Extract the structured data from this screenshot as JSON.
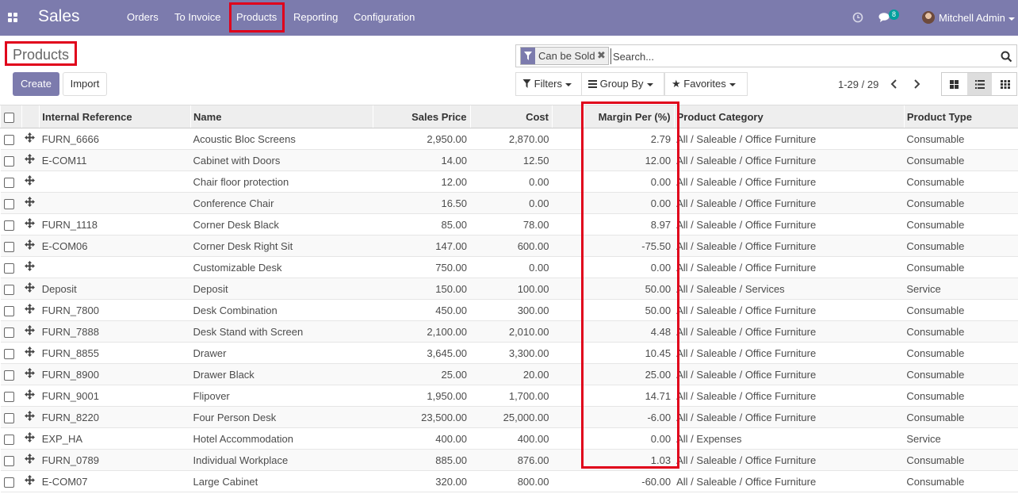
{
  "app": {
    "title": "Sales"
  },
  "menu": [
    {
      "label": "Orders"
    },
    {
      "label": "To Invoice"
    },
    {
      "label": "Products"
    },
    {
      "label": "Reporting"
    },
    {
      "label": "Configuration"
    }
  ],
  "systray": {
    "message_count": "8",
    "user_name": "Mitchell Admin"
  },
  "breadcrumb": {
    "title": "Products"
  },
  "buttons": {
    "create": "Create",
    "import": "Import"
  },
  "search": {
    "facet": "Can be Sold",
    "placeholder": "Search..."
  },
  "filters": {
    "filters": "Filters",
    "group_by": "Group By",
    "favorites": "Favorites"
  },
  "pager": {
    "range": "1-29 / 29"
  },
  "table": {
    "columns": [
      "Internal Reference",
      "Name",
      "Sales Price",
      "Cost",
      "Margin Per (%)",
      "Product Category",
      "Product Type"
    ],
    "rows": [
      [
        "FURN_6666",
        "Acoustic Bloc Screens",
        "2,950.00",
        "2,870.00",
        "2.79",
        "All / Saleable / Office Furniture",
        "Consumable"
      ],
      [
        "E-COM11",
        "Cabinet with Doors",
        "14.00",
        "12.50",
        "12.00",
        "All / Saleable / Office Furniture",
        "Consumable"
      ],
      [
        "",
        "Chair floor protection",
        "12.00",
        "0.00",
        "0.00",
        "All / Saleable / Office Furniture",
        "Consumable"
      ],
      [
        "",
        "Conference Chair",
        "16.50",
        "0.00",
        "0.00",
        "All / Saleable / Office Furniture",
        "Consumable"
      ],
      [
        "FURN_1118",
        "Corner Desk Black",
        "85.00",
        "78.00",
        "8.97",
        "All / Saleable / Office Furniture",
        "Consumable"
      ],
      [
        "E-COM06",
        "Corner Desk Right Sit",
        "147.00",
        "600.00",
        "-75.50",
        "All / Saleable / Office Furniture",
        "Consumable"
      ],
      [
        "",
        "Customizable Desk",
        "750.00",
        "0.00",
        "0.00",
        "All / Saleable / Office Furniture",
        "Consumable"
      ],
      [
        "Deposit",
        "Deposit",
        "150.00",
        "100.00",
        "50.00",
        "All / Saleable / Services",
        "Service"
      ],
      [
        "FURN_7800",
        "Desk Combination",
        "450.00",
        "300.00",
        "50.00",
        "All / Saleable / Office Furniture",
        "Consumable"
      ],
      [
        "FURN_7888",
        "Desk Stand with Screen",
        "2,100.00",
        "2,010.00",
        "4.48",
        "All / Saleable / Office Furniture",
        "Consumable"
      ],
      [
        "FURN_8855",
        "Drawer",
        "3,645.00",
        "3,300.00",
        "10.45",
        "All / Saleable / Office Furniture",
        "Consumable"
      ],
      [
        "FURN_8900",
        "Drawer Black",
        "25.00",
        "20.00",
        "25.00",
        "All / Saleable / Office Furniture",
        "Consumable"
      ],
      [
        "FURN_9001",
        "Flipover",
        "1,950.00",
        "1,700.00",
        "14.71",
        "All / Saleable / Office Furniture",
        "Consumable"
      ],
      [
        "FURN_8220",
        "Four Person Desk",
        "23,500.00",
        "25,000.00",
        "-6.00",
        "All / Saleable / Office Furniture",
        "Consumable"
      ],
      [
        "EXP_HA",
        "Hotel Accommodation",
        "400.00",
        "400.00",
        "0.00",
        "All / Expenses",
        "Service"
      ],
      [
        "FURN_0789",
        "Individual Workplace",
        "885.00",
        "876.00",
        "1.03",
        "All / Saleable / Office Furniture",
        "Consumable"
      ],
      [
        "E-COM07",
        "Large Cabinet",
        "320.00",
        "800.00",
        "-60.00",
        "All / Saleable / Office Furniture",
        "Consumable"
      ]
    ]
  }
}
